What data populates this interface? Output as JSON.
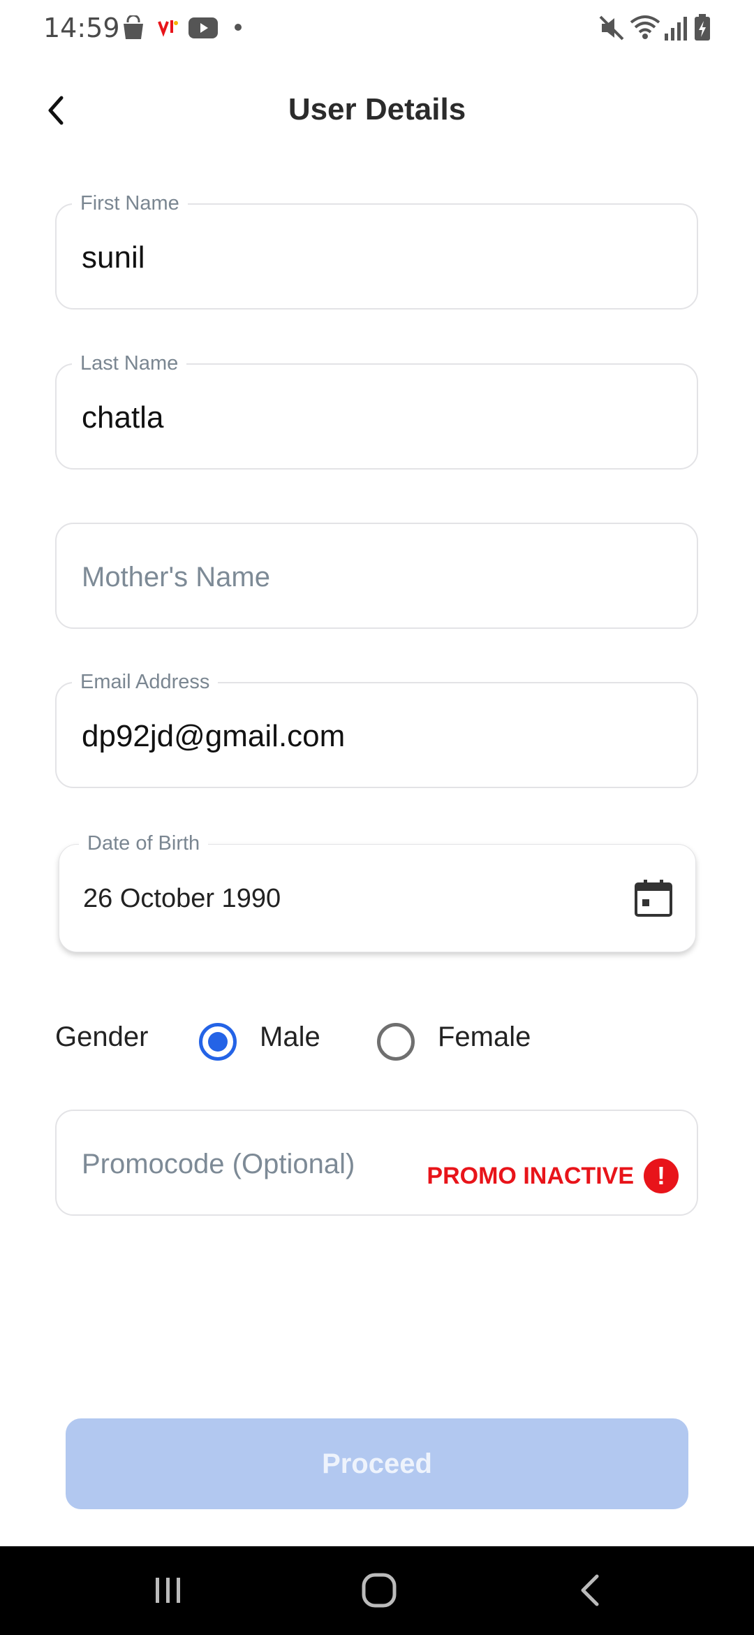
{
  "status_bar": {
    "time": "14:59",
    "left_icons": [
      "shopping-bag-icon",
      "vi-app-icon",
      "youtube-icon",
      "notification-dot-icon"
    ],
    "right_icons": [
      "mute-icon",
      "wifi-icon",
      "signal-icon",
      "battery-charging-icon"
    ]
  },
  "header": {
    "title": "User Details",
    "back_icon": "chevron-left-icon"
  },
  "form": {
    "first_name": {
      "label": "First Name",
      "value": "sunil"
    },
    "last_name": {
      "label": "Last Name",
      "value": "chatla"
    },
    "mothers_name": {
      "placeholder": "Mother's Name",
      "value": ""
    },
    "email": {
      "label": "Email Address",
      "value": "dp92jd@gmail.com"
    },
    "dob": {
      "label": "Date of Birth",
      "value": "26 October 1990",
      "icon": "calendar-icon"
    },
    "gender": {
      "label": "Gender",
      "options": [
        "Male",
        "Female"
      ],
      "selected": "Male"
    },
    "promocode": {
      "placeholder": "Promocode (Optional)",
      "status_text": "PROMO INACTIVE",
      "status_icon": "alert-circle-icon",
      "status_color": "#e8141a"
    }
  },
  "proceed": {
    "label": "Proceed",
    "color": "#b2c8f0",
    "enabled": false
  },
  "accent_color": "#2463e6",
  "nav_bar": {
    "buttons": [
      "recent-apps-icon",
      "home-icon",
      "back-icon"
    ]
  }
}
